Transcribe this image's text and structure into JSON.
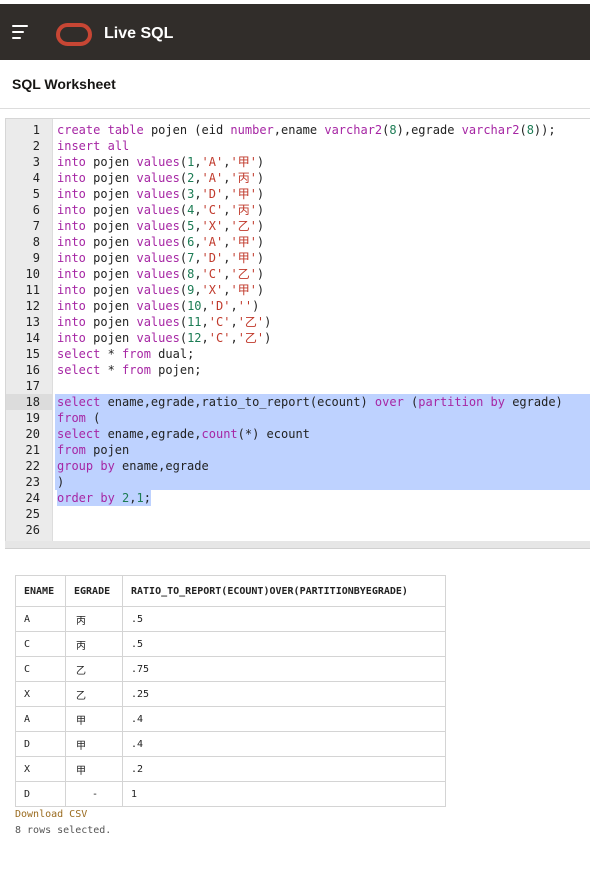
{
  "app": {
    "title": "Live SQL"
  },
  "worksheet": {
    "title": "SQL Worksheet"
  },
  "editor": {
    "lines": [
      "create table pojen (eid number,ename varchar2(8),egrade varchar2(8));",
      "insert all",
      "into pojen values(1,'A','甲')",
      "into pojen values(2,'A','丙')",
      "into pojen values(3,'D','甲')",
      "into pojen values(4,'C','丙')",
      "into pojen values(5,'X','乙')",
      "into pojen values(6,'A','甲')",
      "into pojen values(7,'D','甲')",
      "into pojen values(8,'C','乙')",
      "into pojen values(9,'X','甲')",
      "into pojen values(10,'D','')",
      "into pojen values(11,'C','乙')",
      "into pojen values(12,'C','乙')",
      "select * from dual;",
      "select * from pojen;",
      "",
      "select ename,egrade,ratio_to_report(ecount) over (partition by egrade)",
      "from (",
      "select ename,egrade,count(*) ecount",
      "from pojen",
      "group by ename,egrade",
      ")",
      "order by 2,1;",
      "",
      ""
    ],
    "active_line": 18,
    "selection": {
      "from_line": 18,
      "to_line": 24
    }
  },
  "results": {
    "columns": [
      "ENAME",
      "EGRADE",
      "RATIO_TO_REPORT(ECOUNT)OVER(PARTITIONBYEGRADE)"
    ],
    "rows": [
      [
        "A",
        "丙",
        ".5"
      ],
      [
        "C",
        "丙",
        ".5"
      ],
      [
        "C",
        "乙",
        ".75"
      ],
      [
        "X",
        "乙",
        ".25"
      ],
      [
        "A",
        "甲",
        ".4"
      ],
      [
        "D",
        "甲",
        ".4"
      ],
      [
        "X",
        "甲",
        ".2"
      ],
      [
        "D",
        "-",
        "1"
      ]
    ],
    "download_label": "Download CSV",
    "rows_selected": "8 rows selected."
  },
  "colors": {
    "topbar": "#312d2a",
    "logo": "#c74634",
    "selection": "#bed2ff",
    "keyword": "#a626a4",
    "string": "#c0392b"
  }
}
